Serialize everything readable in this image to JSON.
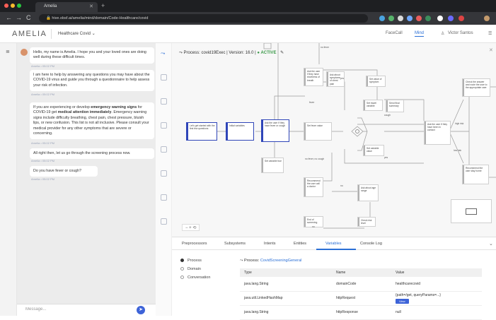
{
  "browser": {
    "tab_title": "Amelia",
    "url": "hive.obsf.ai/amelia/mind/domain/Code-Healthcare/covid"
  },
  "header": {
    "logo": "AMELIA",
    "agent": "Healthcare Covid",
    "links": [
      "FaceCall",
      "Mind",
      "Victor Santos"
    ]
  },
  "chat": {
    "messages": [
      {
        "text": "Hello, my name is Amelia. I hope you and your loved ones are doing well during these difficult times.",
        "time": "Amelia • 05:02 PM"
      },
      {
        "text": "I am here to help by answering any questions you may have about the COVID-19 virus and guide you through a questionnaire to help assess your risk of infection.",
        "time": "Amelia • 05:02 PM"
      },
      {
        "pre": "If you are experiencing or develop ",
        "bold1": "emergency warning signs",
        "mid": " for COVID-19 get ",
        "bold2": "medical attention immediately",
        "post": ". Emergency warning signs include difficulty breathing, chest pain, chest pressure, bluish lips, or new confusion. This list is not all inclusive. Please consult your medical provider for any other symptoms that are severe or concerning.",
        "time": "Amelia • 05:02 PM"
      },
      {
        "text": "All right then, let us go through the screening process now.",
        "time": "Amelia • 05:02 PM"
      },
      {
        "text": "Do you have fever or cough?",
        "time": "Amelia • 05:02 PM"
      }
    ],
    "input_placeholder": "Message..."
  },
  "canvas": {
    "process_label": "Process: covid19Exec",
    "version": "Version: 16.0",
    "status": "ACTIVE",
    "zoom_controls": "−   +   ⟲",
    "nodes": [
      "Let's get started with the first few questions",
      "Initial variables",
      "Ask the user if they have fever or cough",
      "Set fever value",
      "Ask the user if they have shortness of breath",
      "Ask about symptoms of chest pain",
      "Set value of symptom",
      "Set travel variable",
      "Set variable value",
      "Ask the user if they have been in contact",
      "Check the answer and route the user to the appropriate care",
      "Recommend the user stay home",
      "Recommend the user call a doctor",
      "Ask about age range",
      "Check risk level",
      "Set variable true",
      "Send final summary",
      "End of screening"
    ],
    "edge_labels": [
      "no fever",
      "yes",
      "fever",
      "cough",
      "no fever, no cough",
      "yes",
      "no",
      "no",
      "high risk",
      "low risk"
    ]
  },
  "bottom": {
    "tabs": [
      "Preprocessors",
      "Subsystems",
      "Intents",
      "Entities",
      "Variables",
      "Console Log"
    ],
    "selected_tab": "Variables",
    "scopes": [
      "Process",
      "Domain",
      "Conversation"
    ],
    "process_prefix": "Process:",
    "process_name": "CovidScreeningGeneral",
    "table": {
      "headers": [
        "Type",
        "Name",
        "Value"
      ],
      "rows": [
        {
          "type": "java.lang.String",
          "name": "domainCode",
          "value": "healthcarecovid"
        },
        {
          "type": "java.util.LinkedHashMap",
          "name": "httpRequest",
          "value": "{path=/get, queryParams=...}",
          "button": "View"
        },
        {
          "type": "java.lang.String",
          "name": "httpResponse",
          "value": "null"
        }
      ]
    }
  }
}
